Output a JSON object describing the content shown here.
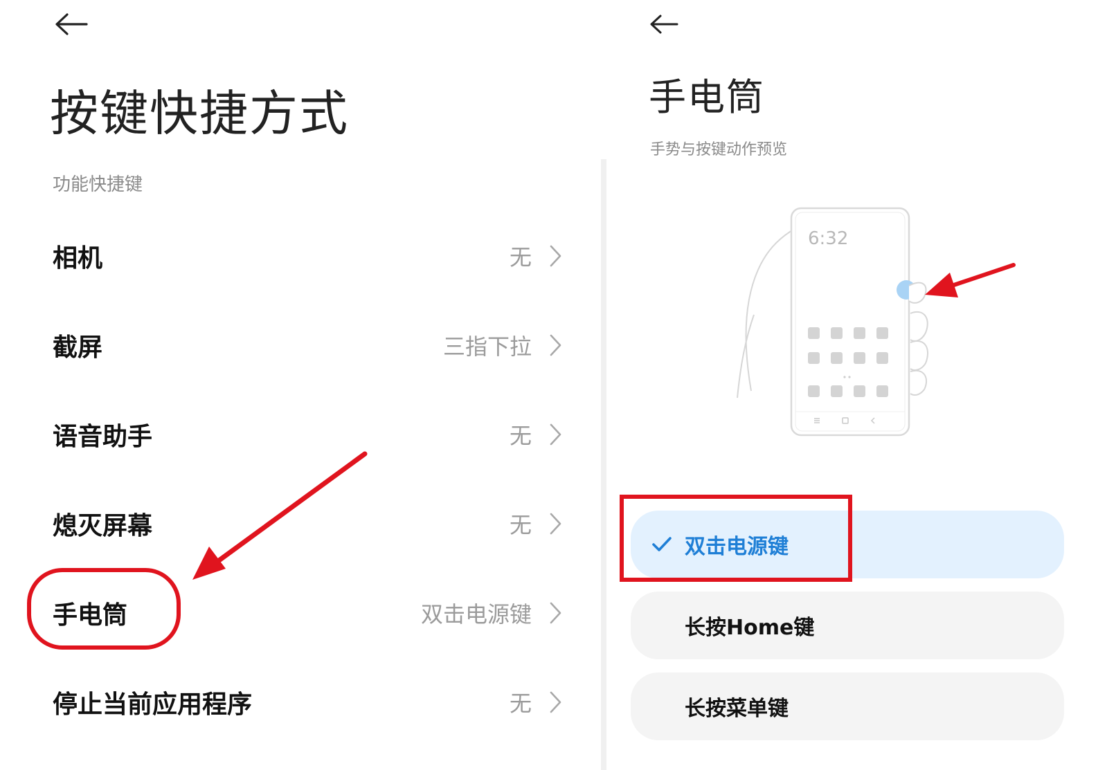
{
  "left": {
    "title": "按键快捷方式",
    "section": "功能快捷键",
    "items": [
      {
        "label": "相机",
        "value": "无"
      },
      {
        "label": "截屏",
        "value": "三指下拉"
      },
      {
        "label": "语音助手",
        "value": "无"
      },
      {
        "label": "熄灭屏幕",
        "value": "无"
      },
      {
        "label": "手电筒",
        "value": "双击电源键"
      },
      {
        "label": "停止当前应用程序",
        "value": "无"
      }
    ]
  },
  "right": {
    "title": "手电筒",
    "section": "手势与按键动作预览",
    "preview": {
      "clock": "6:32"
    },
    "options": [
      {
        "label": "双击电源键",
        "selected": true
      },
      {
        "label": "长按Home键",
        "selected": false
      },
      {
        "label": "长按菜单键",
        "selected": false
      }
    ]
  },
  "colors": {
    "accent": "#1f7fd6",
    "selected_bg": "#e3f1fe",
    "annotation_red": "#e0141e"
  }
}
